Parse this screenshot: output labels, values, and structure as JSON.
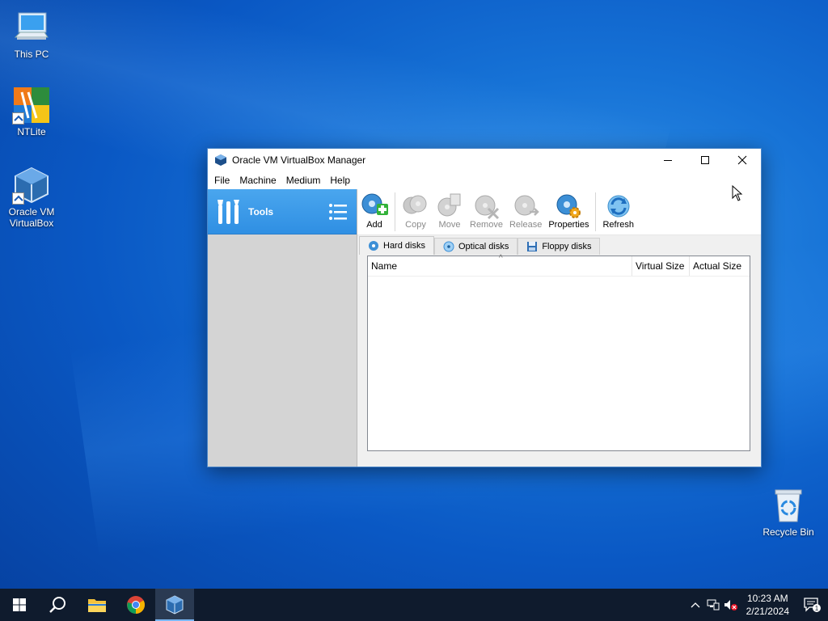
{
  "desktop": {
    "icons": [
      {
        "label": "This PC"
      },
      {
        "label": "NTLite"
      },
      {
        "label": "Oracle VM VirtualBox"
      },
      {
        "label": "Recycle Bin"
      }
    ]
  },
  "window": {
    "title": "Oracle VM VirtualBox Manager",
    "menu": [
      "File",
      "Machine",
      "Medium",
      "Help"
    ],
    "left_pane": {
      "tools_label": "Tools"
    },
    "toolbar": [
      {
        "label": "Add",
        "enabled": true
      },
      {
        "label": "Copy",
        "enabled": false
      },
      {
        "label": "Move",
        "enabled": false
      },
      {
        "label": "Remove",
        "enabled": false
      },
      {
        "label": "Release",
        "enabled": false
      },
      {
        "label": "Properties",
        "enabled": true
      },
      {
        "label": "Refresh",
        "enabled": true
      }
    ],
    "tabs": [
      {
        "label": "Hard disks",
        "active": true
      },
      {
        "label": "Optical disks",
        "active": false
      },
      {
        "label": "Floppy disks",
        "active": false
      }
    ],
    "table": {
      "columns": [
        "Name",
        "Virtual Size",
        "Actual Size"
      ],
      "rows": []
    }
  },
  "taskbar": {
    "time": "10:23 AM",
    "date": "2/21/2024",
    "notification_count": "1"
  },
  "colors": {
    "accent": "#2f8fe3",
    "taskbar": "#0f1b2d",
    "desktop": "#0a58c4"
  }
}
